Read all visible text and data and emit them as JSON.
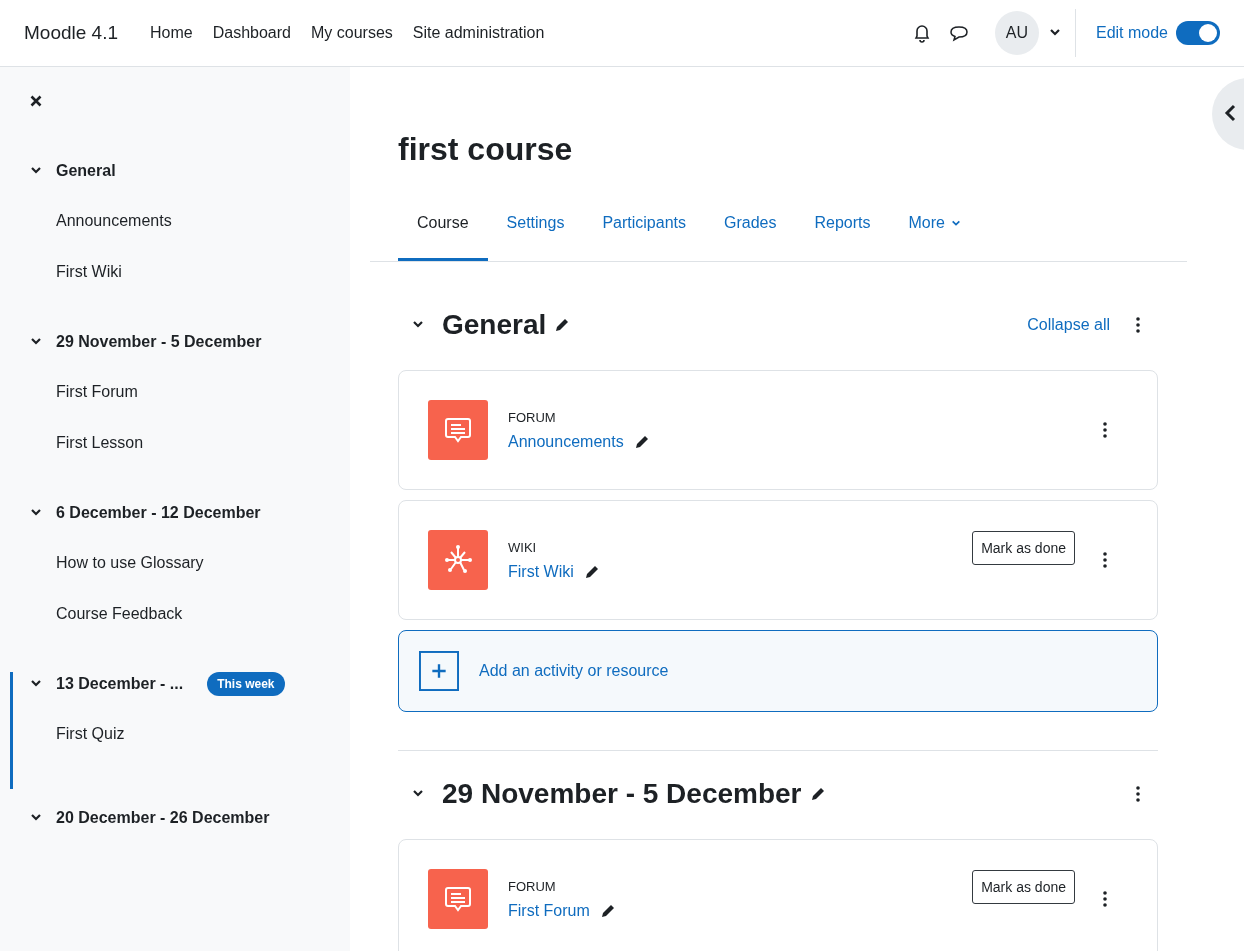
{
  "navbar": {
    "brand": "Moodle 4.1",
    "links": [
      "Home",
      "Dashboard",
      "My courses",
      "Site administration"
    ],
    "avatar": "AU",
    "edit_mode": {
      "label": "Edit mode",
      "on": true
    }
  },
  "sidebar": {
    "sections": [
      {
        "title": "General",
        "expanded": true,
        "current": false,
        "items": [
          "Announcements",
          "First Wiki"
        ]
      },
      {
        "title": "29 November - 5 December",
        "expanded": true,
        "current": false,
        "items": [
          "First Forum",
          "First Lesson"
        ]
      },
      {
        "title": "6 December - 12 December",
        "expanded": true,
        "current": false,
        "items": [
          "How to use Glossary",
          "Course Feedback"
        ]
      },
      {
        "title": "13 December - ...",
        "expanded": true,
        "current": true,
        "badge": "This week",
        "items": [
          "First Quiz"
        ]
      },
      {
        "title": "20 December - 26 December",
        "expanded": true,
        "current": false
      }
    ]
  },
  "course": {
    "title": "first course",
    "tabs": [
      {
        "label": "Course",
        "selected": true,
        "kind": "link"
      },
      {
        "label": "Settings",
        "selected": false,
        "kind": "link"
      },
      {
        "label": "Participants",
        "selected": false,
        "kind": "link"
      },
      {
        "label": "Grades",
        "selected": false,
        "kind": "link"
      },
      {
        "label": "Reports",
        "selected": false,
        "kind": "link"
      },
      {
        "label": "More",
        "selected": false,
        "kind": "dropdown"
      }
    ],
    "sections": [
      {
        "title": "General",
        "expanded": true,
        "collapse_label": "Collapse all",
        "add_label": "Add an activity or resource",
        "activities": [
          {
            "kind": "forum",
            "type": "FORUM",
            "name": "Announcements"
          },
          {
            "kind": "wiki",
            "type": "WIKI",
            "name": "First Wiki",
            "button": "Mark as done"
          }
        ]
      },
      {
        "title": "29 November - 5 December",
        "expanded": true,
        "activities": [
          {
            "kind": "forum",
            "type": "FORUM",
            "name": "First Forum",
            "button": "Mark as done"
          }
        ]
      }
    ]
  }
}
